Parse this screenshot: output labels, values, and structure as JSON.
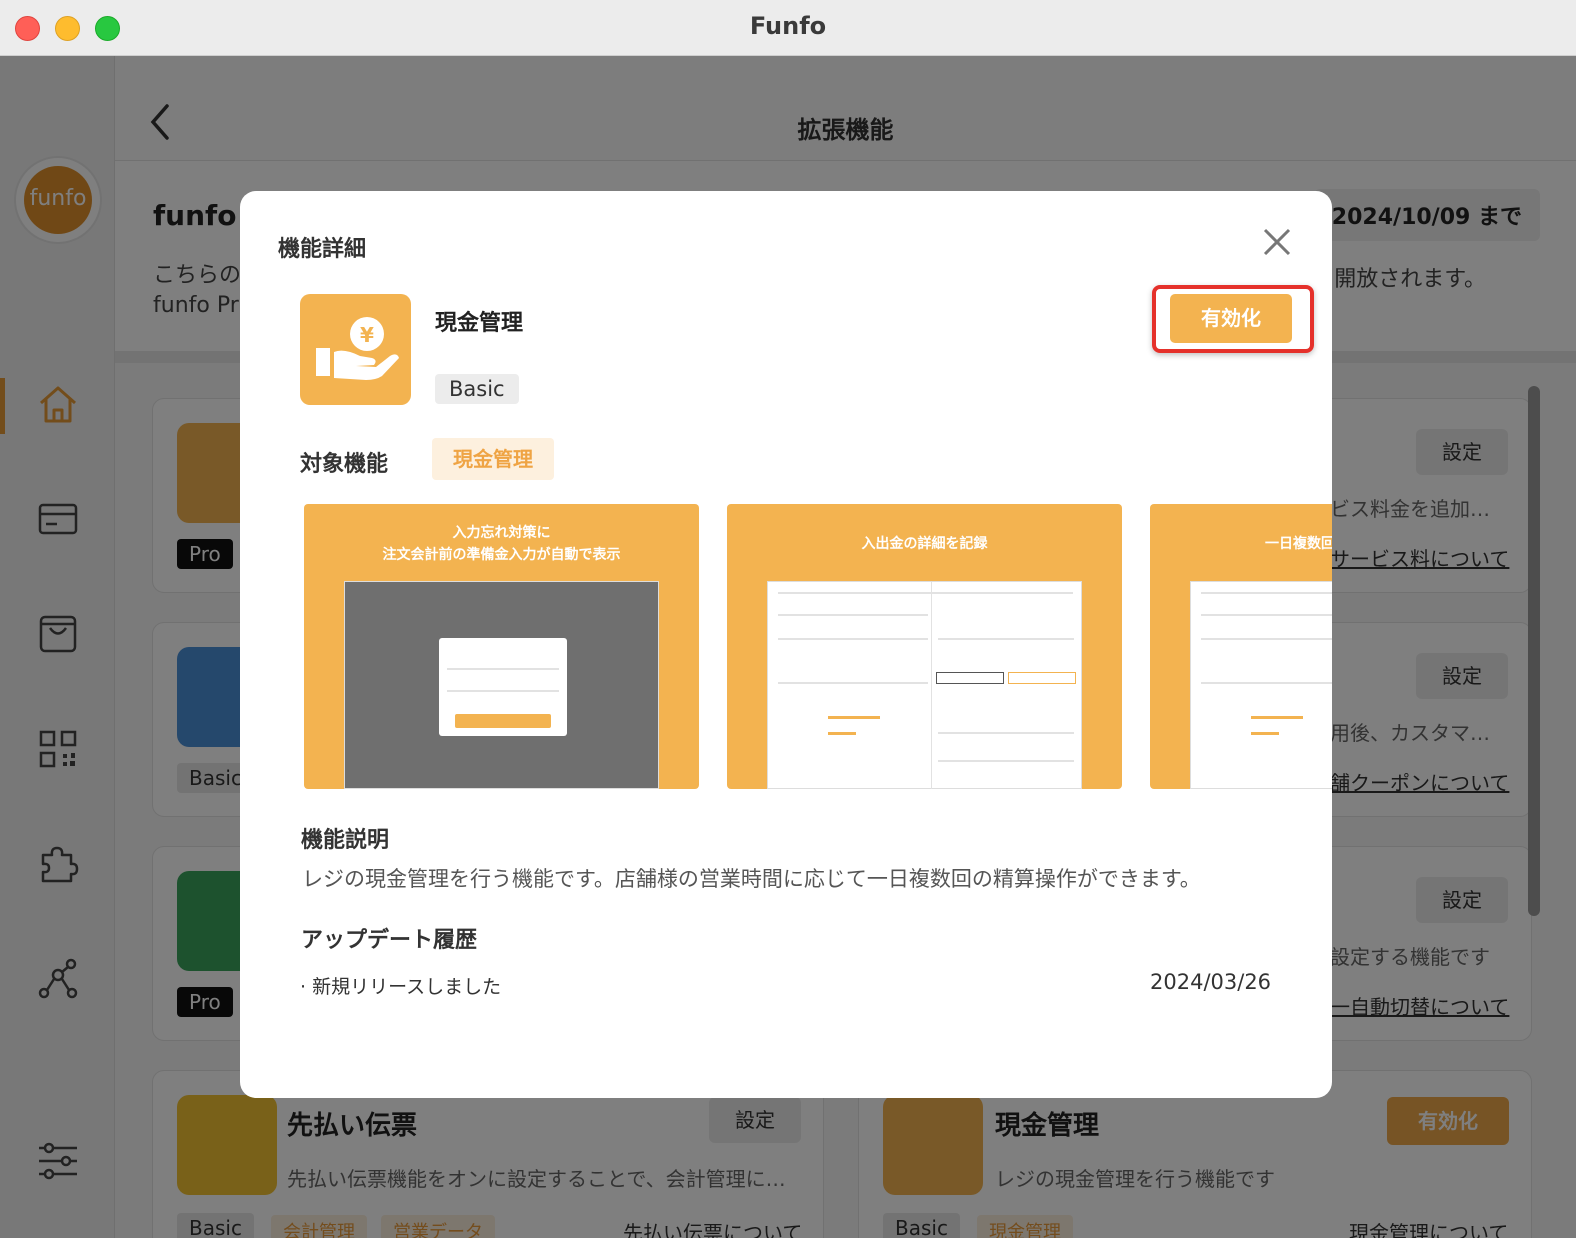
{
  "window": {
    "title": "Funfo"
  },
  "header": {
    "title": "拡張機能"
  },
  "sidebar": {
    "logo_text": "funfo"
  },
  "plan": {
    "title": "funfo P",
    "expiry": "2024/10/09 まで",
    "desc_line1": "こちらの",
    "desc_line2": "funfo Pr",
    "desc_right": "開放されます。"
  },
  "cards": {
    "c1": {
      "badge": "Pro",
      "setting": "設定",
      "desc": "ビス料金を追加…",
      "link": "サービス料について"
    },
    "c2": {
      "badge": "Basic",
      "setting": "設定",
      "desc": "用後、カスタマ…",
      "link": "舗クーポンについて"
    },
    "c3": {
      "badge": "Pro",
      "setting": "設定",
      "desc": "設定する機能です",
      "link": "一自動切替について"
    },
    "c4": {
      "title": "先払い伝票",
      "setting": "設定",
      "desc": "先払い伝票機能をオンに設定することで、会計管理に…",
      "badges": [
        "Basic",
        "会計管理",
        "営業データ"
      ],
      "link": "先払い伝票について"
    },
    "c5": {
      "title": "現金管理",
      "enable": "有効化",
      "desc": "レジの現金管理を行う機能です",
      "badges": [
        "Basic",
        "現金管理"
      ],
      "link": "現金管理について"
    }
  },
  "modal": {
    "title": "機能詳細",
    "feature_name": "現金管理",
    "plan_badge": "Basic",
    "enable_label": "有効化",
    "target_label": "対象機能",
    "target_tag": "現金管理",
    "screenshots": [
      {
        "caption_line1": "入力忘れ対策に",
        "caption_line2": "注文会計前の準備金入力が自動で表示"
      },
      {
        "caption_line1": "入出金の詳細を記録",
        "caption_line2": ""
      },
      {
        "caption_line1": "一日複数回",
        "caption_line2": ""
      }
    ],
    "description_label": "機能説明",
    "description": "レジの現金管理を行う機能です。店舗様の営業時間に応じて一日複数回の精算操作ができます。",
    "history_label": "アップデート履歴",
    "history": [
      {
        "text": "· 新規リリースしました",
        "date": "2024/03/26"
      }
    ]
  },
  "colors": {
    "accent": "#f3b350",
    "highlight": "#e5312b"
  },
  "icons": [
    "home-icon",
    "card-icon",
    "bag-icon",
    "qr-icon",
    "puzzle-icon",
    "network-icon",
    "sliders-icon",
    "close-icon",
    "back-icon",
    "yen-hand-icon"
  ]
}
